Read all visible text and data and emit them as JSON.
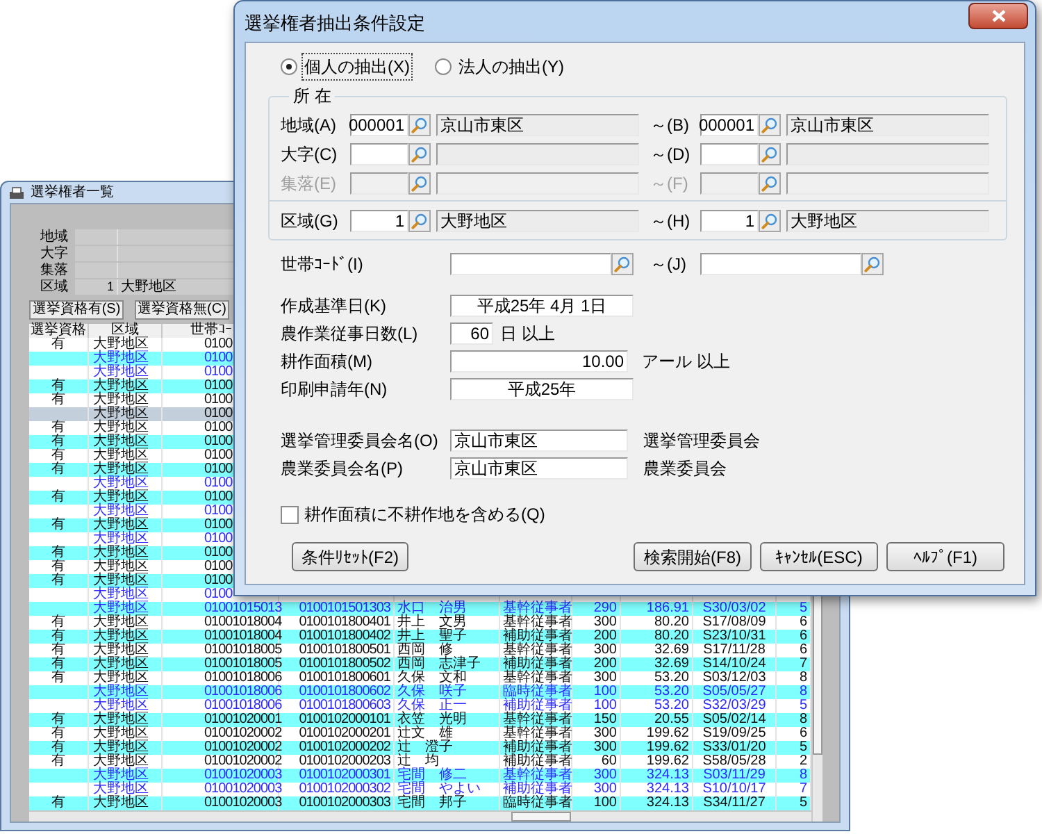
{
  "list_window": {
    "title": "選挙権者一覧",
    "filters": [
      {
        "label": "地域"
      },
      {
        "label": "大字"
      },
      {
        "label": "集落"
      },
      {
        "label": "区域",
        "code": "1",
        "name": "大野地区"
      }
    ],
    "buttons": [
      "選挙資格有(S)",
      "選挙資格無(C)"
    ],
    "columns": [
      "選挙資格",
      "区域",
      "世帯ｺｰ"
    ],
    "rows": [
      {
        "qualification": "有",
        "district": "大野地区",
        "household_code": "0100",
        "selected": false,
        "emphasized": false
      },
      {
        "district": "大野地区",
        "household_code": "0100",
        "selected": false,
        "emphasized": true
      },
      {
        "district": "大野地区",
        "household_code": "0100",
        "selected": false,
        "emphasized": true
      },
      {
        "qualification": "有",
        "district": "大野地区",
        "household_code": "0100",
        "selected": false,
        "emphasized": false
      },
      {
        "qualification": "有",
        "district": "大野地区",
        "household_code": "0100",
        "selected": false,
        "emphasized": false
      },
      {
        "district": "大野地区",
        "household_code": "0100",
        "selected": true,
        "emphasized": false
      },
      {
        "qualification": "有",
        "district": "大野地区",
        "household_code": "0100",
        "selected": false,
        "emphasized": false
      },
      {
        "qualification": "有",
        "district": "大野地区",
        "household_code": "0100",
        "selected": false,
        "emphasized": false
      },
      {
        "qualification": "有",
        "district": "大野地区",
        "household_code": "0100",
        "selected": false,
        "emphasized": false
      },
      {
        "qualification": "有",
        "district": "大野地区",
        "household_code": "0100",
        "selected": false,
        "emphasized": false
      },
      {
        "district": "大野地区",
        "household_code": "0100",
        "selected": false,
        "emphasized": true
      },
      {
        "qualification": "有",
        "district": "大野地区",
        "household_code": "0100",
        "selected": false,
        "emphasized": false
      },
      {
        "district": "大野地区",
        "household_code": "0100",
        "selected": false,
        "emphasized": true
      },
      {
        "qualification": "有",
        "district": "大野地区",
        "household_code": "0100",
        "selected": false,
        "emphasized": false
      },
      {
        "district": "大野地区",
        "household_code": "0100",
        "selected": false,
        "emphasized": true
      },
      {
        "qualification": "有",
        "district": "大野地区",
        "household_code": "0100",
        "selected": false,
        "emphasized": false
      },
      {
        "qualification": "有",
        "district": "大野地区",
        "household_code": "0100",
        "selected": false,
        "emphasized": false
      },
      {
        "qualification": "有",
        "district": "大野地区",
        "household_code": "0100",
        "selected": false,
        "emphasized": false
      },
      {
        "district": "大野地区",
        "household_code": "0100",
        "selected": false,
        "emphasized": true
      },
      {
        "district": "大野地区",
        "household_code": "01001015013",
        "person_code": "0100101501303",
        "name": "水口　治男",
        "category": "基幹従事者",
        "days": "290",
        "area": "186.91",
        "birth_date": "S30/03/02",
        "column_10": "5",
        "selected": false,
        "emphasized": true
      },
      {
        "qualification": "有",
        "district": "大野地区",
        "household_code": "01001018004",
        "person_code": "0100101800401",
        "name": "井上　文男",
        "category": "基幹従事者",
        "days": "300",
        "area": "80.20",
        "birth_date": "S17/08/09",
        "column_10": "6",
        "selected": false,
        "emphasized": false
      },
      {
        "qualification": "有",
        "district": "大野地区",
        "household_code": "01001018004",
        "person_code": "0100101800402",
        "name": "井上　聖子",
        "category": "補助従事者",
        "days": "200",
        "area": "80.20",
        "birth_date": "S23/10/31",
        "column_10": "6",
        "selected": false,
        "emphasized": false
      },
      {
        "qualification": "有",
        "district": "大野地区",
        "household_code": "01001018005",
        "person_code": "0100101800501",
        "name": "西岡　修",
        "category": "基幹従事者",
        "days": "300",
        "area": "32.69",
        "birth_date": "S17/11/28",
        "column_10": "6",
        "selected": false,
        "emphasized": false
      },
      {
        "qualification": "有",
        "district": "大野地区",
        "household_code": "01001018005",
        "person_code": "0100101800502",
        "name": "西岡　志津子",
        "category": "補助従事者",
        "days": "200",
        "area": "32.69",
        "birth_date": "S14/10/24",
        "column_10": "7",
        "selected": false,
        "emphasized": false
      },
      {
        "qualification": "有",
        "district": "大野地区",
        "household_code": "01001018006",
        "person_code": "0100101800601",
        "name": "久保　文和",
        "category": "基幹従事者",
        "days": "300",
        "area": "53.20",
        "birth_date": "S03/12/03",
        "column_10": "8",
        "selected": false,
        "emphasized": false
      },
      {
        "district": "大野地区",
        "household_code": "01001018006",
        "person_code": "0100101800602",
        "name": "久保　咲子",
        "category": "臨時従事者",
        "days": "100",
        "area": "53.20",
        "birth_date": "S05/05/27",
        "column_10": "8",
        "selected": false,
        "emphasized": true
      },
      {
        "district": "大野地区",
        "household_code": "01001018006",
        "person_code": "0100101800603",
        "name": "久保　正一",
        "category": "補助従事者",
        "days": "100",
        "area": "53.20",
        "birth_date": "S32/03/29",
        "column_10": "5",
        "selected": false,
        "emphasized": true
      },
      {
        "qualification": "有",
        "district": "大野地区",
        "household_code": "01001020001",
        "person_code": "0100102000101",
        "name": "衣笠　光明",
        "category": "基幹従事者",
        "days": "150",
        "area": "20.55",
        "birth_date": "S05/02/14",
        "column_10": "8",
        "selected": false,
        "emphasized": false
      },
      {
        "qualification": "有",
        "district": "大野地区",
        "household_code": "01001020002",
        "person_code": "0100102000201",
        "name": "辻文　雄",
        "category": "基幹従事者",
        "days": "300",
        "area": "199.62",
        "birth_date": "S19/09/25",
        "column_10": "6",
        "selected": false,
        "emphasized": false
      },
      {
        "qualification": "有",
        "district": "大野地区",
        "household_code": "01001020002",
        "person_code": "0100102000202",
        "name": "辻　澄子",
        "category": "補助従事者",
        "days": "300",
        "area": "199.62",
        "birth_date": "S33/01/20",
        "column_10": "5",
        "selected": false,
        "emphasized": false
      },
      {
        "qualification": "有",
        "district": "大野地区",
        "household_code": "01001020002",
        "person_code": "0100102000203",
        "name": "辻　均",
        "category": "補助従事者",
        "days": "60",
        "area": "199.62",
        "birth_date": "S58/05/28",
        "column_10": "2",
        "selected": false,
        "emphasized": false
      },
      {
        "district": "大野地区",
        "household_code": "01001020003",
        "person_code": "0100102000301",
        "name": "宅間　修二",
        "category": "基幹従事者",
        "days": "300",
        "area": "324.13",
        "birth_date": "S03/11/29",
        "column_10": "8",
        "selected": false,
        "emphasized": true
      },
      {
        "district": "大野地区",
        "household_code": "01001020003",
        "person_code": "0100102000302",
        "name": "宅間　やよい",
        "category": "補助従事者",
        "days": "300",
        "area": "324.13",
        "birth_date": "S10/10/17",
        "column_10": "7",
        "selected": false,
        "emphasized": true
      },
      {
        "qualification": "有",
        "district": "大野地区",
        "household_code": "01001020003",
        "person_code": "0100102000303",
        "name": "宅間　邦子",
        "category": "臨時従事者",
        "days": "100",
        "area": "324.13",
        "birth_date": "S34/11/27",
        "column_10": "5",
        "selected": false,
        "emphasized": false
      }
    ]
  },
  "dialog": {
    "title": "選挙権者抽出条件設定",
    "target_options": [
      {
        "label": "個人の抽出(X)",
        "selected": true
      },
      {
        "label": "法人の抽出(Y)",
        "selected": false
      }
    ],
    "location": {
      "title": "所 在",
      "rows": [
        {
          "label": "地域(A)",
          "from_code": "000001",
          "from_name": "京山市東区",
          "to_label": "～(B)",
          "to_code": "000001",
          "to_name": "京山市東区",
          "disabled": false
        },
        {
          "label": "大字(C)",
          "to_label": "～(D)",
          "disabled": false
        },
        {
          "label": "集落(E)",
          "to_label": "～(F)",
          "disabled": true
        }
      ],
      "district": {
        "label": "区域(G)",
        "from_code": "1",
        "from_name": "大野地区",
        "to_label": "～(H)",
        "to_code": "1",
        "to_name": "大野地区",
        "disabled": false
      }
    },
    "household_code": {
      "label": "世帯ｺｰﾄﾞ(I)",
      "to_label": "～(J)"
    },
    "base_date": {
      "label": "作成基準日(K)",
      "value": "平成25年  4月  1日"
    },
    "work_days": {
      "label": "農作業従事日数(L)",
      "value": "60",
      "unit": "日 以上"
    },
    "cultivated_area": {
      "label": "耕作面積(M)",
      "value": "10.00",
      "unit": "アール 以上"
    },
    "print_year": {
      "label": "印刷申請年(N)",
      "value": "平成25年"
    },
    "committees": [
      {
        "label": "選挙管理委員会名(O)",
        "value": "京山市東区",
        "suffix": "選挙管理委員会"
      },
      {
        "label": "農業委員会名(P)",
        "value": "京山市東区",
        "suffix": "農業委員会"
      }
    ],
    "include_uncultivated": {
      "label": "耕作面積に不耕作地を含める(Q)",
      "checked": false
    },
    "reset_button": "条件ﾘｾｯﾄ(F2)",
    "buttons": [
      "検索開始(F8)",
      "ｷｬﾝｾﾙ(ESC)",
      "ﾍﾙﾌﾟ(F1)"
    ]
  }
}
